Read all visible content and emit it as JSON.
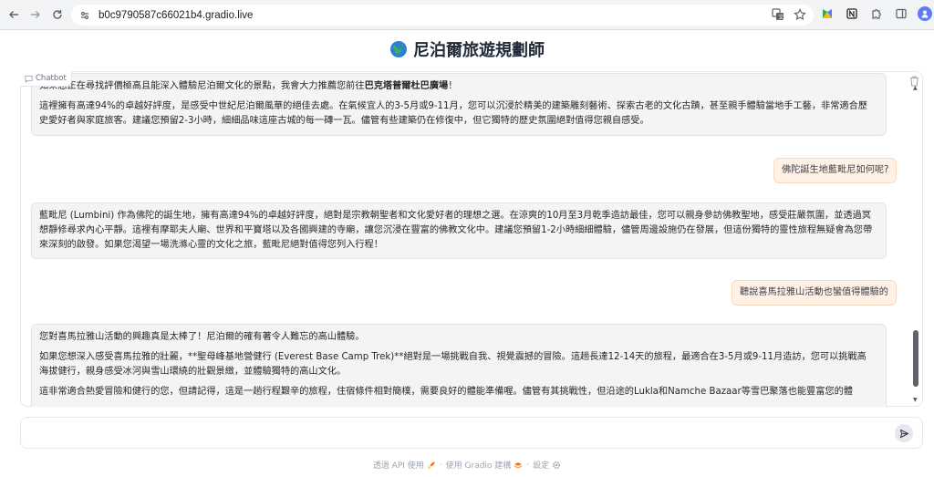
{
  "browser": {
    "url": "b0c9790587c66021b4.gradio.live"
  },
  "app": {
    "title": "尼泊爾旅遊規劃師",
    "chatbot_label": "Chatbot",
    "input_placeholder": ""
  },
  "messages": [
    {
      "role": "bot",
      "paragraphs": [
        {
          "pre": "如果您正在尋找評價極高且能深入體驗尼泊爾文化的景點，我會大力推薦您前往",
          "strong": "巴克塔普爾杜巴廣場",
          "post": "！"
        },
        {
          "text": "這裡擁有高達94%的卓越好評度，是感受中世紀尼泊爾風華的絕佳去處。在氣候宜人的3-5月或9-11月，您可以沉浸於精美的建築雕刻藝術、探索古老的文化古蹟，甚至親手體驗當地手工藝，非常適合歷史愛好者與家庭旅客。建議您預留2-3小時，細細品味這座古城的每一磚一瓦。儘管有些建築仍在修復中，但它獨特的歷史氛圍絕對值得您親自感受。"
        }
      ]
    },
    {
      "role": "user",
      "text": "佛陀誕生地藍毗尼如何呢?"
    },
    {
      "role": "bot",
      "text": "藍毗尼 (Lumbini) 作為佛陀的誕生地，擁有高達94%的卓越好評度，絕對是宗教朝聖者和文化愛好者的理想之選。在涼爽的10月至3月乾季造訪最佳，您可以親身參訪佛教聖地，感受莊嚴氛圍，並透過冥想靜修尋求內心平靜。這裡有摩耶夫人廟、世界和平寶塔以及各國興建的寺廟，讓您沉浸在豐富的佛教文化中。建議您預留1-2小時細細體驗，儘管周邊設施仍在發展，但這份獨特的靈性旅程無疑會為您帶來深刻的啟發。如果您渴望一場洗滌心靈的文化之旅，藍毗尼絕對值得您列入行程！"
    },
    {
      "role": "user",
      "text": "聽說喜馬拉雅山活動也蠻值得體驗的"
    },
    {
      "role": "bot",
      "paragraphs": [
        {
          "text": "您對喜馬拉雅山活動的興趣真是太棒了！尼泊爾的確有著令人難忘的高山體驗。"
        },
        {
          "text": "如果您想深入感受喜馬拉雅的壯麗，**聖母峰基地營健行 (Everest Base Camp Trek)**絕對是一場挑戰自我、視覺震撼的冒險。這趟長達12-14天的旅程，最適合在3-5月或9-11月造訪，您可以挑戰高海拔健行，親身感受冰河與雪山環繞的壯觀景緻，並體驗獨特的高山文化。"
        },
        {
          "text": "這非常適合熱愛冒險和健行的您，但請記得，這是一趟行程艱辛的旅程，住宿條件相對簡樸，需要良好的體能準備喔。儘管有其挑戰性，但沿途的Lukla和Namche Bazaar等雪巴聚落也能豐富您的體"
        }
      ]
    }
  ],
  "footer": {
    "api": "透過 API 使用",
    "built": "使用 Gradio 建構",
    "settings": "設定",
    "sep": "·"
  }
}
